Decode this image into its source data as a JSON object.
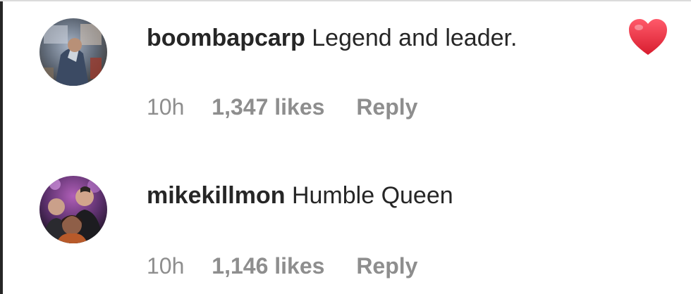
{
  "comments": [
    {
      "username": "boombapcarp",
      "text": "Legend and leader.",
      "reaction_icon": "heart-icon",
      "time": "10h",
      "likes": "1,347 likes",
      "reply_label": "Reply"
    },
    {
      "username": "mikekillmon",
      "text": "Humble Queen",
      "time": "10h",
      "likes": "1,146 likes",
      "reply_label": "Reply"
    }
  ],
  "colors": {
    "text_primary": "#262626",
    "text_secondary": "#8e8e8e",
    "heart": "#ed4956"
  }
}
